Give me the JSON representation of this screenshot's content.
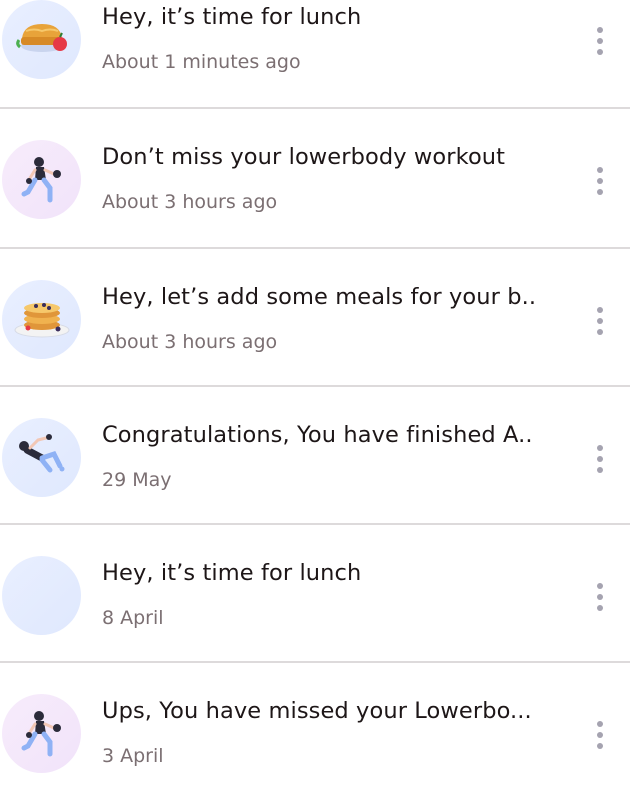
{
  "notifications": [
    {
      "title": "Hey, it’s time for lunch",
      "time": "About 1 minutes ago",
      "icon": "lunch-icon"
    },
    {
      "title": "Don’t miss your lowerbody workout",
      "time": "About 3 hours ago",
      "icon": "workout-icon"
    },
    {
      "title": "Hey, let’s add some meals for your b..",
      "time": "About 3 hours ago",
      "icon": "pancake-icon"
    },
    {
      "title": "Congratulations, You have finished A..",
      "time": "29 May",
      "icon": "exercise-icon"
    },
    {
      "title": "Hey, it’s time for lunch",
      "time": "8 April",
      "icon": "blank-avatar"
    },
    {
      "title": "Ups, You have missed your Lowerbo...",
      "time": "3 April",
      "icon": "workout-icon"
    }
  ],
  "colors": {
    "title": "#1d1617",
    "subtitle": "#7b6f72",
    "divider": "#dddadb",
    "menu_dot": "#a5a3b0",
    "avatar_blue": "#e9efff",
    "avatar_pink": "#f7ecfb"
  }
}
